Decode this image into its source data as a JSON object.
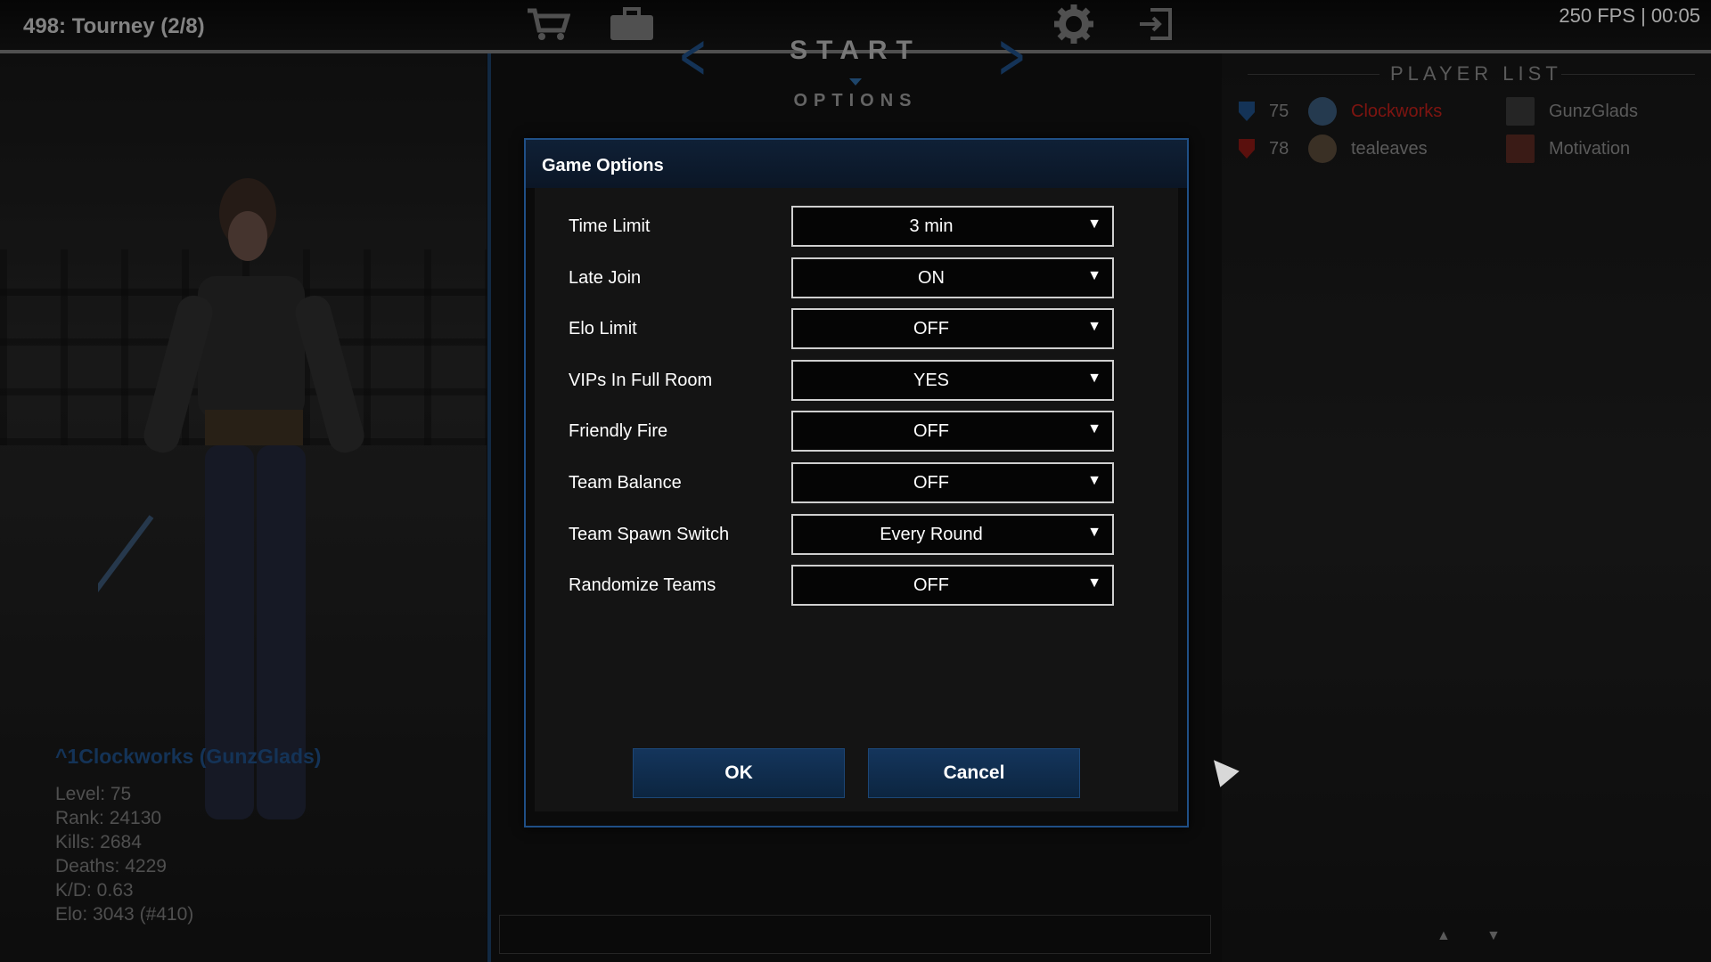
{
  "window": {
    "room_title": "498: Tourney (2/8)",
    "fps": "250 FPS | 00:05"
  },
  "top_nav": {
    "start_label": "START",
    "options_label": "OPTIONS",
    "icons": [
      "shopping-cart-icon",
      "briefcase-icon",
      "gear-icon",
      "exit-icon"
    ]
  },
  "player": {
    "name": "^1Clockworks (GunzGlads)",
    "stats": [
      "Level: 75",
      "Rank: 24130",
      "Kills: 2684",
      "Deaths: 4229",
      "K/D: 0.63",
      "Elo: 3043 (#410)"
    ]
  },
  "player_list": {
    "title": "PLAYER LIST",
    "players": [
      {
        "level": "75",
        "name": "Clockworks",
        "clan": "GunzGlads",
        "name_color": "#c0201a"
      },
      {
        "level": "78",
        "name": "tealeaves",
        "clan": "Motivation",
        "name_color": "#8a8a8a"
      }
    ]
  },
  "dialog": {
    "title": "Game Options",
    "options": [
      {
        "label": "Time Limit",
        "value": "3 min"
      },
      {
        "label": "Late Join",
        "value": "ON"
      },
      {
        "label": "Elo Limit",
        "value": "OFF"
      },
      {
        "label": "VIPs In Full Room",
        "value": "YES"
      },
      {
        "label": "Friendly Fire",
        "value": "OFF"
      },
      {
        "label": "Team Balance",
        "value": "OFF"
      },
      {
        "label": "Team Spawn Switch",
        "value": "Every Round"
      },
      {
        "label": "Randomize Teams",
        "value": "OFF"
      }
    ],
    "ok_label": "OK",
    "cancel_label": "Cancel"
  },
  "colors": {
    "accent_blue": "#1f4f86",
    "player_name_red": "#c0201a"
  }
}
